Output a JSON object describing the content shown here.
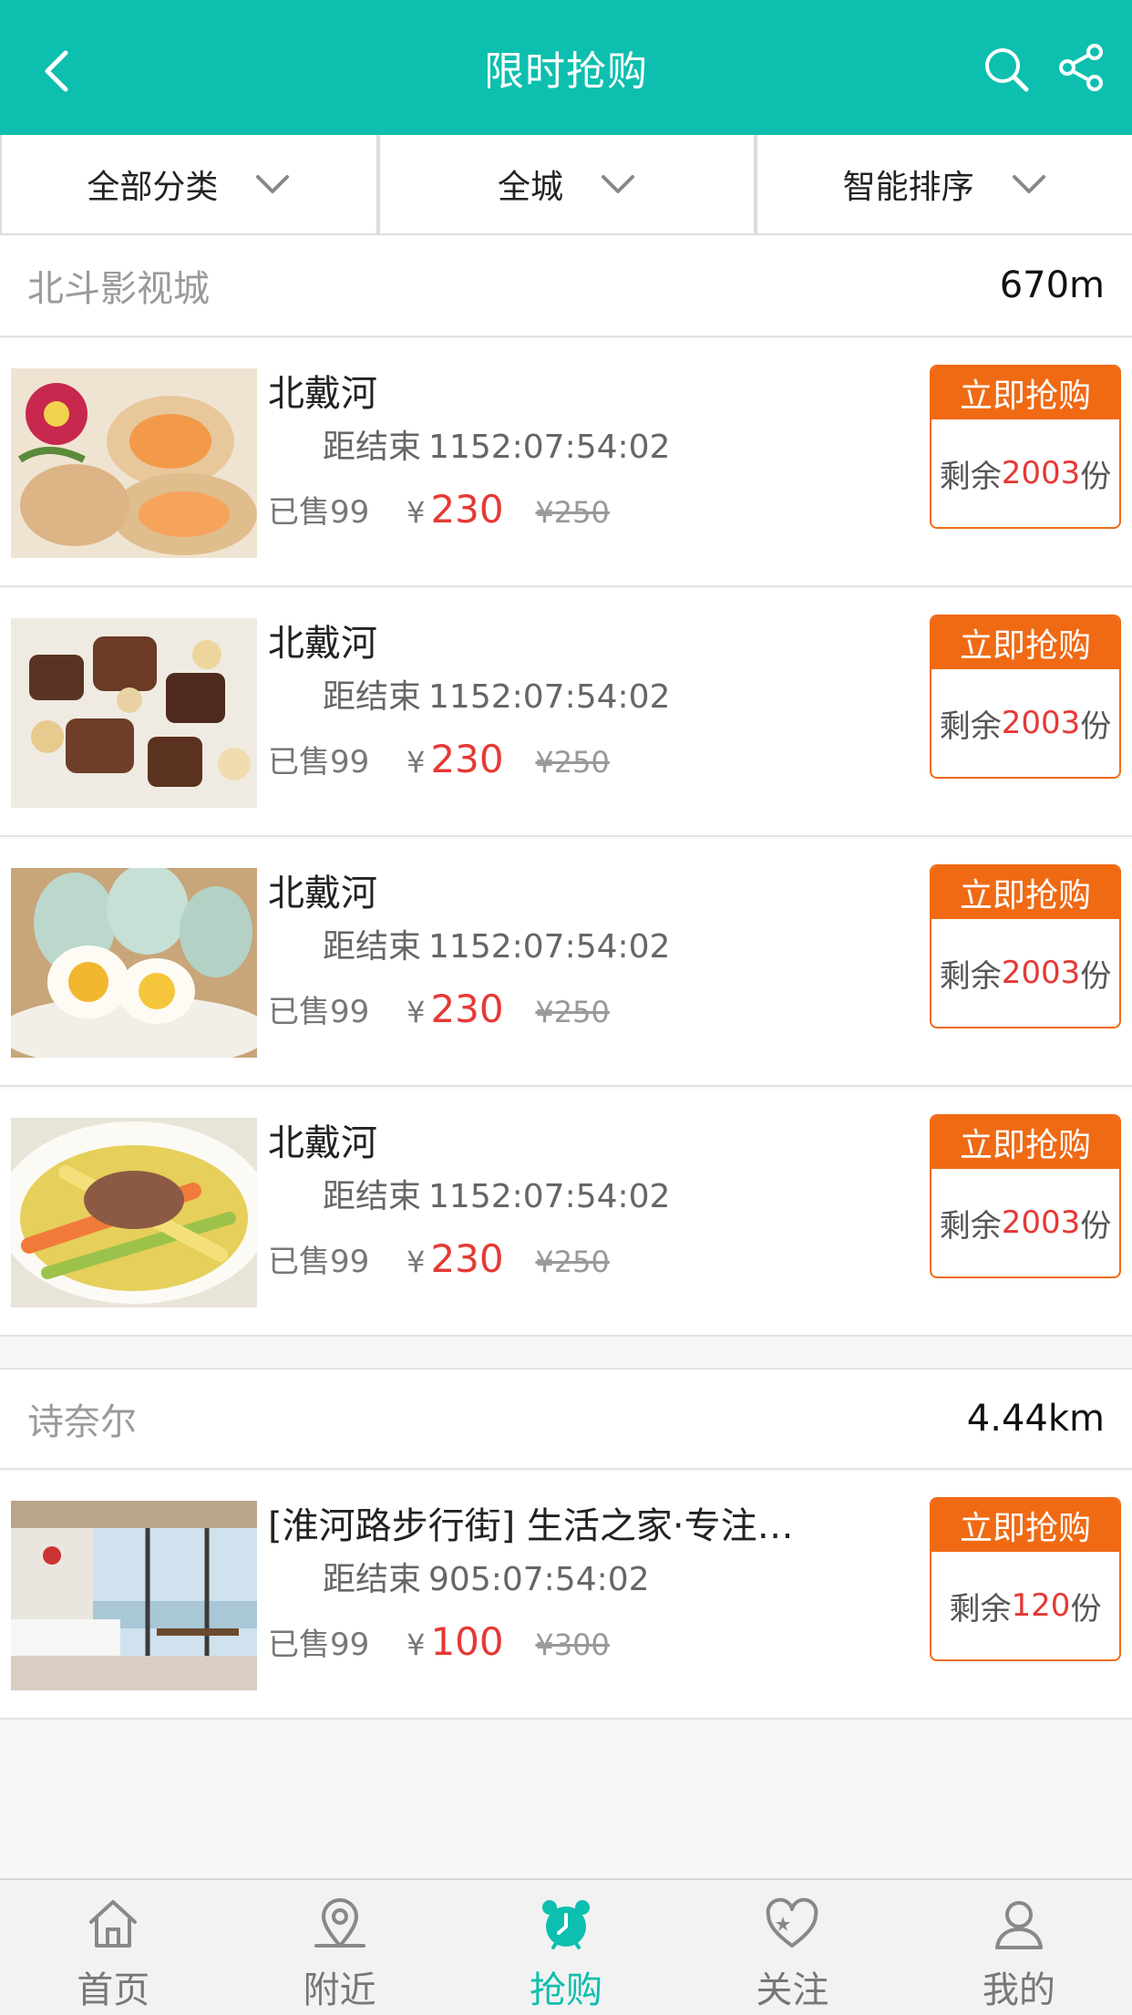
{
  "header": {
    "title": "限时抢购"
  },
  "filters": [
    "全部分类",
    "全城",
    "智能排序"
  ],
  "shops": [
    {
      "name": "北斗影视城",
      "distance": "670m"
    },
    {
      "name": "诗奈尔",
      "distance": "4.44km"
    }
  ],
  "items": [
    {
      "name": "北戴河",
      "timer_label": "距结束",
      "timer": "1152:07:54:02",
      "sold": "已售99",
      "currency": "¥",
      "price": "230",
      "orig": "¥250",
      "buy": "立即抢购",
      "left_pre": "剩余",
      "left_num": "2003",
      "left_post": "份"
    },
    {
      "name": "北戴河",
      "timer_label": "距结束",
      "timer": "1152:07:54:02",
      "sold": "已售99",
      "currency": "¥",
      "price": "230",
      "orig": "¥250",
      "buy": "立即抢购",
      "left_pre": "剩余",
      "left_num": "2003",
      "left_post": "份"
    },
    {
      "name": "北戴河",
      "timer_label": "距结束",
      "timer": "1152:07:54:02",
      "sold": "已售99",
      "currency": "¥",
      "price": "230",
      "orig": "¥250",
      "buy": "立即抢购",
      "left_pre": "剩余",
      "left_num": "2003",
      "left_post": "份"
    },
    {
      "name": "北戴河",
      "timer_label": "距结束",
      "timer": "1152:07:54:02",
      "sold": "已售99",
      "currency": "¥",
      "price": "230",
      "orig": "¥250",
      "buy": "立即抢购",
      "left_pre": "剩余",
      "left_num": "2003",
      "left_post": "份"
    },
    {
      "name": "[淮河路步行街] 生活之家·专注…",
      "timer_label": "距结束",
      "timer": "905:07:54:02",
      "sold": "已售99",
      "currency": "¥",
      "price": "100",
      "orig": "¥300",
      "buy": "立即抢购",
      "left_pre": "剩余",
      "left_num": "120",
      "left_post": "份"
    }
  ],
  "tabs": [
    "首页",
    "附近",
    "抢购",
    "关注",
    "我的"
  ],
  "colors": {
    "brand": "#0dbfae",
    "accent": "#f06a14",
    "price": "#e53935"
  }
}
